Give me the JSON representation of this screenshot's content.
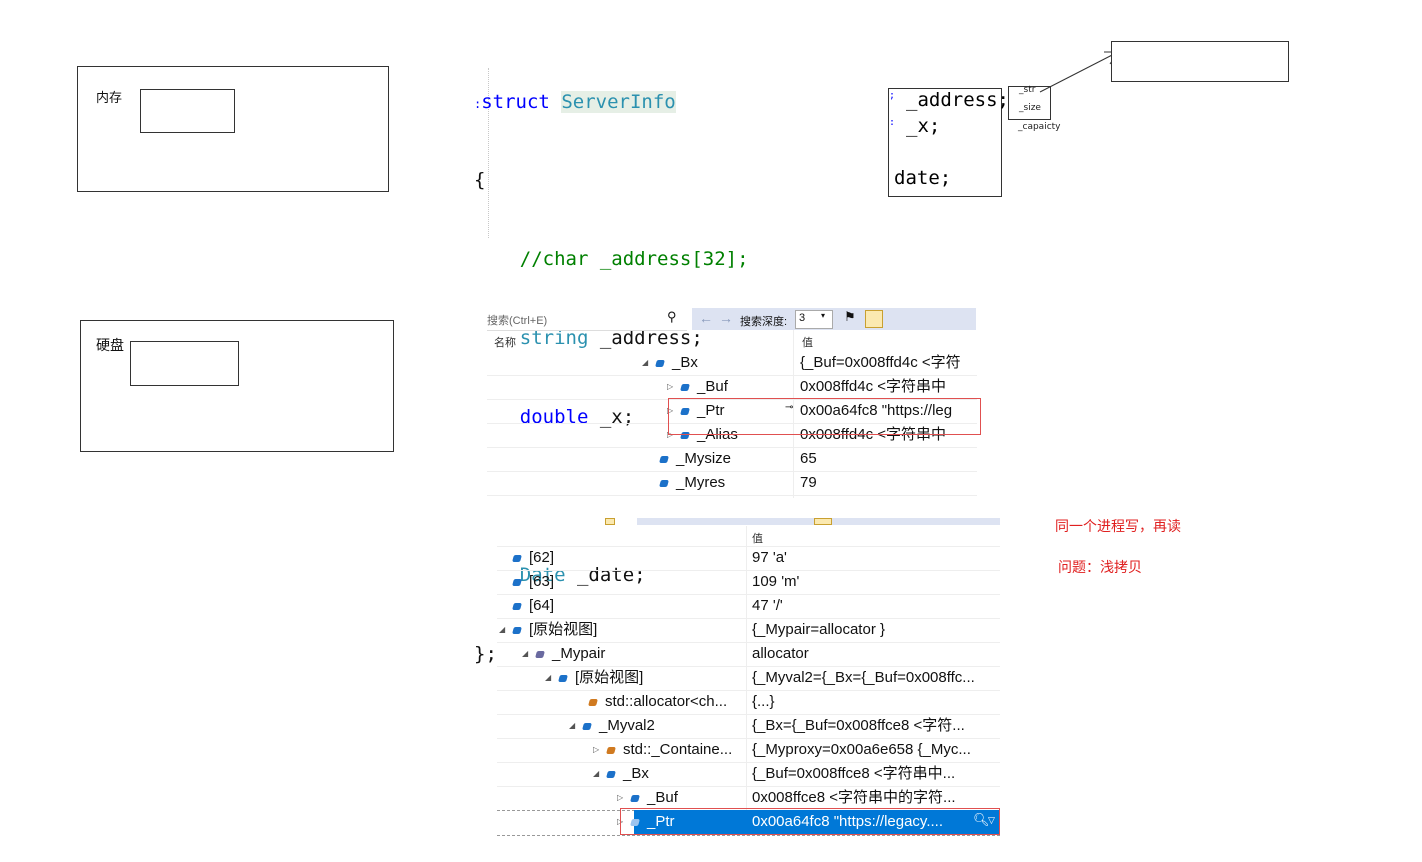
{
  "memory_box": {
    "label": "内存"
  },
  "disk_box": {
    "label": "硬盘"
  },
  "code": {
    "line1_kw": "struct",
    "line1_name": "ServerInfo",
    "open": "{",
    "comment": "//char _address[32];",
    "l3_type": "string",
    "l3_rest": " _address;",
    "l4_type": "double",
    "l4_rest": " _x;",
    "l6_type": "Date",
    "l6_rest": " _date;",
    "close": "};"
  },
  "mini_struct": {
    "address": "_address;",
    "x": "_x;",
    "date": "date;",
    "str": "_str",
    "size": "_size",
    "capacity": "_capaicty"
  },
  "watch1": {
    "search_placeholder": "搜索(Ctrl+E)",
    "depth_label": "搜索深度:",
    "depth_value": "3",
    "col_name": "名称",
    "col_value": "值",
    "rows": [
      {
        "name": "_Bx",
        "value": "{_Buf=0x008ffd4c <字符"
      },
      {
        "name": "_Buf",
        "value": "0x008ffd4c <字符串中"
      },
      {
        "name": "_Ptr",
        "value": "0x00a64fc8 \"https://leg"
      },
      {
        "name": "_Alias",
        "value": "0x008ffd4c <字符串中"
      },
      {
        "name": "_Mysize",
        "value": "65"
      },
      {
        "name": "_Myres",
        "value": "79"
      }
    ]
  },
  "watch2": {
    "col_value": "值",
    "rows": [
      {
        "name": "[62]",
        "value": "97 'a'"
      },
      {
        "name": "[63]",
        "value": "109 'm'"
      },
      {
        "name": "[64]",
        "value": "47 '/'"
      },
      {
        "name": "[原始视图]",
        "value": "{_Mypair=allocator }"
      },
      {
        "name": "_Mypair",
        "value": "allocator"
      },
      {
        "name": "[原始视图]",
        "value": "{_Myval2={_Bx={_Buf=0x008ffc..."
      },
      {
        "name": "std::allocator<ch...",
        "value": "{...}"
      },
      {
        "name": "_Myval2",
        "value": "{_Bx={_Buf=0x008ffce8 <字符..."
      },
      {
        "name": "std::_Containe...",
        "value": "{_Myproxy=0x00a6e658 {_Myc..."
      },
      {
        "name": "_Bx",
        "value": "{_Buf=0x008ffce8 <字符串中..."
      },
      {
        "name": "_Buf",
        "value": "0x008ffce8 <字符串中的字符..."
      },
      {
        "name": "_Ptr",
        "value": "0x00a64fc8 \"https://legacy...."
      }
    ]
  },
  "notes": {
    "note1": "同一个进程写，再读",
    "note2": "问题：浅拷贝"
  },
  "colors": {
    "keyword": "#0000ff",
    "type": "#2b91af",
    "comment": "#008000",
    "annotation": "#e02020",
    "selection": "#0078d7"
  }
}
